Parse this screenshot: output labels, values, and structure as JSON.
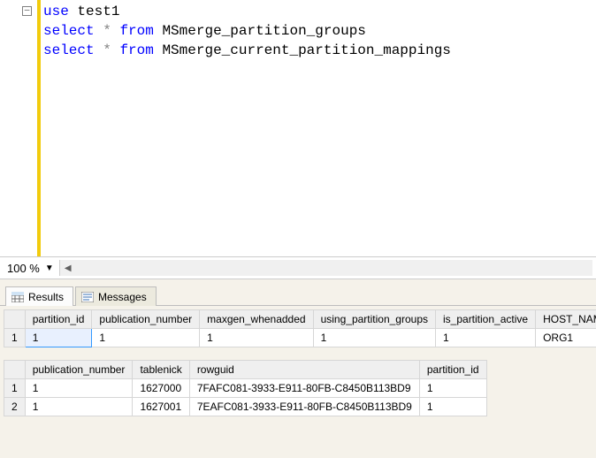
{
  "editor": {
    "lines": [
      {
        "segments": [
          {
            "t": "use",
            "c": "kw"
          },
          {
            "t": " ",
            "c": ""
          },
          {
            "t": "test1",
            "c": "ident"
          }
        ]
      },
      {
        "segments": [
          {
            "t": "select",
            "c": "kw"
          },
          {
            "t": " ",
            "c": ""
          },
          {
            "t": "*",
            "c": "op"
          },
          {
            "t": " ",
            "c": ""
          },
          {
            "t": "from",
            "c": "kw"
          },
          {
            "t": " ",
            "c": ""
          },
          {
            "t": "MSmerge_partition_groups",
            "c": "ident"
          }
        ]
      },
      {
        "segments": [
          {
            "t": "select",
            "c": "kw"
          },
          {
            "t": " ",
            "c": ""
          },
          {
            "t": "*",
            "c": "op"
          },
          {
            "t": " ",
            "c": ""
          },
          {
            "t": "from",
            "c": "kw"
          },
          {
            "t": " ",
            "c": ""
          },
          {
            "t": "MSmerge_current_partition_mappings",
            "c": "ident"
          }
        ]
      }
    ]
  },
  "zoom": {
    "label": "100 %"
  },
  "tabs": {
    "results": "Results",
    "messages": "Messages"
  },
  "grid1": {
    "headers": [
      "partition_id",
      "publication_number",
      "maxgen_whenadded",
      "using_partition_groups",
      "is_partition_active",
      "HOST_NAME_FN"
    ],
    "rows": [
      [
        "1",
        "1",
        "1",
        "1",
        "1",
        "ORG1"
      ]
    ]
  },
  "grid2": {
    "headers": [
      "publication_number",
      "tablenick",
      "rowguid",
      "partition_id"
    ],
    "rows": [
      [
        "1",
        "1627000",
        "7FAFC081-3933-E911-80FB-C8450B113BD9",
        "1"
      ],
      [
        "1",
        "1627001",
        "7EAFC081-3933-E911-80FB-C8450B113BD9",
        "1"
      ]
    ]
  }
}
